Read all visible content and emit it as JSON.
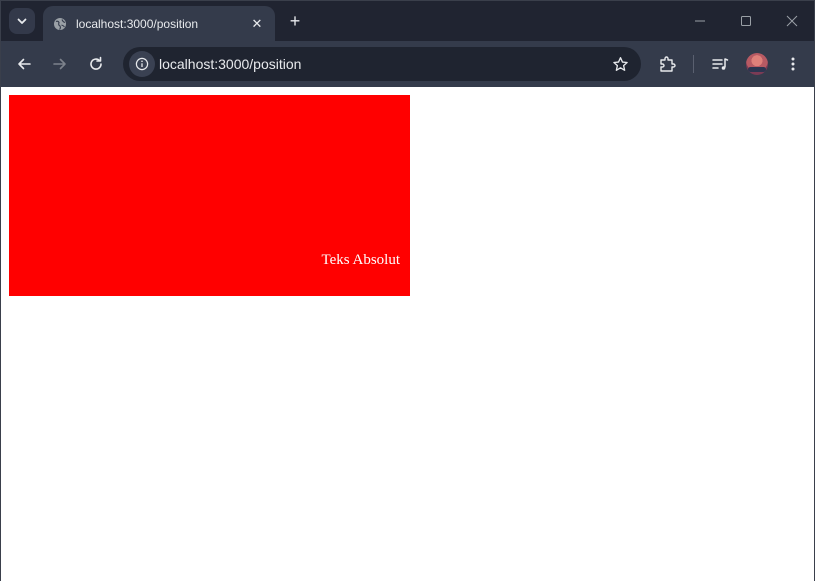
{
  "browser": {
    "tab": {
      "title": "localhost:3000/position",
      "close_glyph": "✕",
      "favicon": "globe-icon"
    },
    "new_tab_glyph": "+",
    "address_bar": {
      "url": "localhost:3000/position"
    },
    "icons": [
      "tab-search-icon",
      "back-icon",
      "forward-icon",
      "reload-icon",
      "site-info-icon",
      "bookmark-star-icon",
      "extensions-icon",
      "media-controls-icon",
      "profile-avatar",
      "menu-icon",
      "minimize-icon",
      "maximize-icon",
      "close-window-icon"
    ],
    "colors": {
      "frame": "#202431",
      "toolbar": "#343b4b",
      "omnibox": "#1f2430",
      "text": "#e8eaed"
    }
  },
  "page": {
    "box": {
      "color": "#ff0000",
      "text": "Teks Absolut",
      "text_color": "#ffffff"
    },
    "background": "#ffffff"
  }
}
